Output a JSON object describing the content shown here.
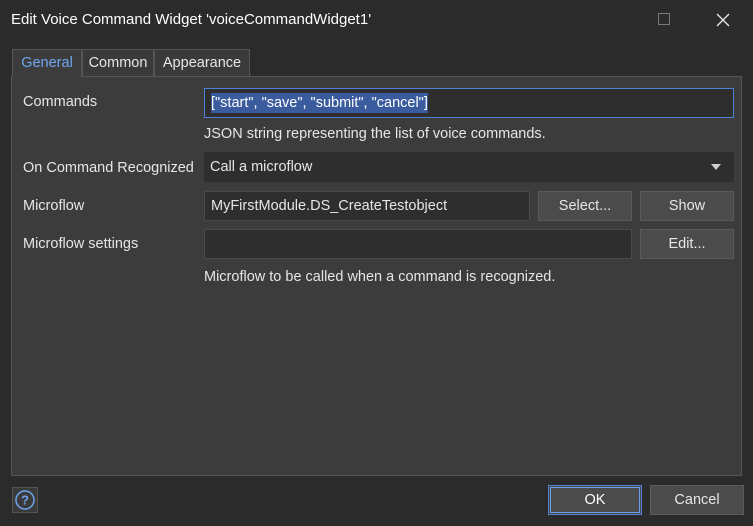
{
  "window": {
    "title": "Edit Voice Command Widget 'voiceCommandWidget1'"
  },
  "tabs": [
    {
      "label": "General",
      "active": true
    },
    {
      "label": "Common",
      "active": false
    },
    {
      "label": "Appearance",
      "active": false
    }
  ],
  "form": {
    "commands": {
      "label": "Commands",
      "value": "[\"start\", \"save\", \"submit\", \"cancel\"]",
      "hint": "JSON string representing the list of voice commands."
    },
    "on_command_recognized": {
      "label": "On Command Recognized",
      "value": "Call a microflow"
    },
    "microflow": {
      "label": "Microflow",
      "value": "MyFirstModule.DS_CreateTestobject",
      "select_label": "Select...",
      "show_label": "Show"
    },
    "microflow_settings": {
      "label": "Microflow settings",
      "value": "",
      "edit_label": "Edit...",
      "hint": "Microflow to be called when a command is recognized."
    }
  },
  "footer": {
    "ok_label": "OK",
    "cancel_label": "Cancel"
  },
  "colors": {
    "accent": "#4f7fd6",
    "active_tab_text": "#6fa6ef",
    "panel_background": "#3c3c3c",
    "window_background": "#2b2b2b"
  },
  "icons": {
    "maximize": "maximize-icon",
    "close": "close-icon",
    "help": "help-icon",
    "dropdown": "chevron-down-icon"
  }
}
